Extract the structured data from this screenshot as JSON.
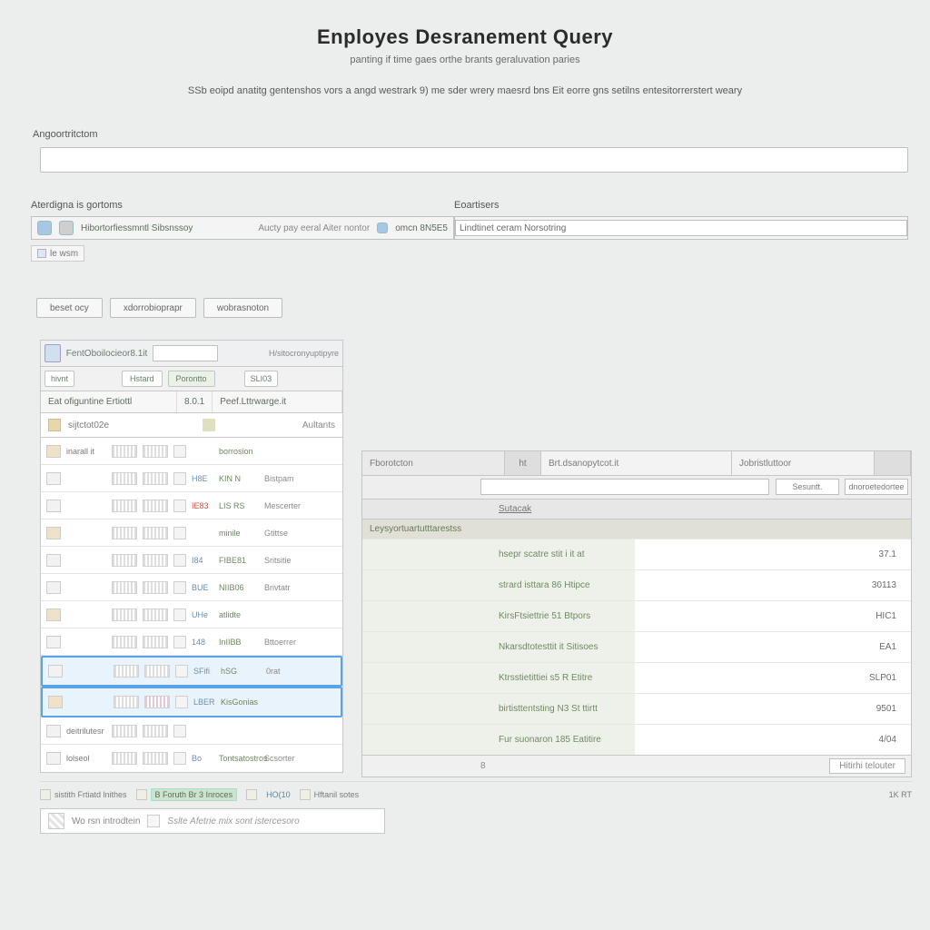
{
  "header": {
    "title": "Enployes Desranement Query",
    "subtitle": "panting if time gaes orthe brants geraluvation paries",
    "description": "SSb eoipd anatitg gentenshos vors a angd westrark 9) me sder wrery maesrd bns Eit eorre gns setilns entesitorrerstert weary"
  },
  "argsLabel": "Angoortritctom",
  "twoCol": {
    "leftLabel": "Aterdigna is gortoms",
    "rightLabel": "Eoartisers",
    "leftText": "Hibortorfiessmntl Sibsnssoy",
    "midText": "Aucty pay eeral Aiter nontor",
    "chipVal": "omcn 8N5E5",
    "rightVal": "Lindtinet ceram Norsotring",
    "smallChip": "le wsm"
  },
  "buttons": [
    "beset ocy",
    "xdorrobioprapr",
    "wobrasnoton"
  ],
  "leftGrid": {
    "title": "FentOboilocieor8.1it",
    "sideBtn": "hivnt",
    "tabs": [
      "Hstard",
      "Porontto",
      "SLI03"
    ],
    "colA": "Eat ofiguntine Ertiottl",
    "colB": "8.0.1",
    "colC": "Peef.Lttrwarge.it",
    "subA": "sijtctot02e",
    "subB": "Aultants",
    "rows": [
      {
        "name": "inarall it",
        "num": "",
        "v1": "borrosion",
        "v2": ""
      },
      {
        "name": "",
        "num": "H8E",
        "v1": "KIN N",
        "v2": "Bistpam"
      },
      {
        "name": "",
        "num": "IE83",
        "v1": "LIS RS",
        "v2": "Mescerter",
        "red": true
      },
      {
        "name": "",
        "num": "",
        "v1": "minile",
        "v2": "Gtittse"
      },
      {
        "name": "",
        "num": "I84",
        "v1": "FIBE81",
        "v2": "Sritsitie"
      },
      {
        "name": "",
        "num": "BUE",
        "v1": "NIIB06",
        "v2": "Brivtatr"
      },
      {
        "name": "",
        "num": "UHe",
        "v1": "atlidte",
        "v2": ""
      },
      {
        "name": "",
        "num": "148",
        "v1": "InIIBB",
        "v2": "Bttoerrer"
      },
      {
        "name": "",
        "num": "SFifi",
        "v1": "hSG",
        "v2": "0rat",
        "sel": true
      },
      {
        "name": "",
        "num": "LBER",
        "v1": "KisGonias",
        "v2": "",
        "sel": true
      },
      {
        "name": "deitrilutesr",
        "num": "",
        "v1": "",
        "v2": ""
      },
      {
        "name": "lolseol",
        "num": "Bo",
        "v1": "Tontsatostros",
        "v2": "Scsorter"
      }
    ]
  },
  "rightPanel": {
    "topLabel": "H/sitocronyuptipyre",
    "col1": "Fborotcton",
    "col2": "ht",
    "col3": "Brt.dsanopytcot.it",
    "col4": "Jobristluttoor",
    "searchPlaceholder": "",
    "miniBtn1": "Sesuntt.",
    "miniBtn2": "dnoroetedortee",
    "listHead": "Sutacak",
    "group": "Leysyortuartutttarestss",
    "rows": [
      {
        "name": "hsepr scatre stit i it at",
        "val": "37.1"
      },
      {
        "name": "strard isttara 86 Htipce",
        "val": "30113"
      },
      {
        "name": "KirsFtsiettrie 51 Btpors",
        "val": "HIC1"
      },
      {
        "name": "Nkarsdtotesttit it   Sitisoes",
        "val": "EA1"
      },
      {
        "name": "Ktrsstietittiei s5 R Etitre",
        "val": "SLP01"
      },
      {
        "name": "birtisttentsting N3 St ttirtt",
        "val": "9501"
      },
      {
        "name": "Fur suonaron 185 Eatitire",
        "val": "4/04"
      }
    ],
    "footerBtn": "Hitirhi telouter",
    "footerPage": "8"
  },
  "statusBar": {
    "s1Label": "sistith Frtiatd lnithes",
    "s2Label": "B Foruth Br 3 Inroces",
    "s3Label": "",
    "s4Num": "HO(10",
    "s5": "Hftanil sotes",
    "s6": "1K RT"
  },
  "selBox": {
    "label": "Wo rsn introdtein",
    "italic": "Sslte Afetrie mix sont istercesoro"
  }
}
